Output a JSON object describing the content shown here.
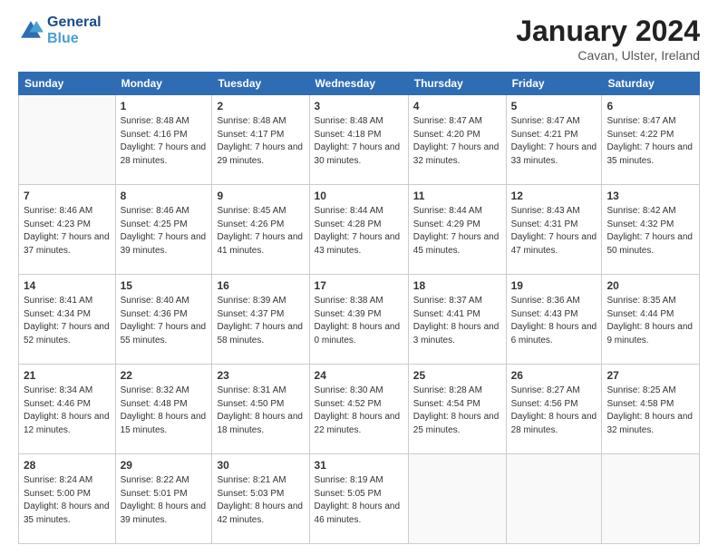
{
  "header": {
    "logo_line1": "General",
    "logo_line2": "Blue",
    "month": "January 2024",
    "location": "Cavan, Ulster, Ireland"
  },
  "days_of_week": [
    "Sunday",
    "Monday",
    "Tuesday",
    "Wednesday",
    "Thursday",
    "Friday",
    "Saturday"
  ],
  "weeks": [
    [
      {
        "day": "",
        "sunrise": "",
        "sunset": "",
        "daylight": ""
      },
      {
        "day": "1",
        "sunrise": "Sunrise: 8:48 AM",
        "sunset": "Sunset: 4:16 PM",
        "daylight": "Daylight: 7 hours and 28 minutes."
      },
      {
        "day": "2",
        "sunrise": "Sunrise: 8:48 AM",
        "sunset": "Sunset: 4:17 PM",
        "daylight": "Daylight: 7 hours and 29 minutes."
      },
      {
        "day": "3",
        "sunrise": "Sunrise: 8:48 AM",
        "sunset": "Sunset: 4:18 PM",
        "daylight": "Daylight: 7 hours and 30 minutes."
      },
      {
        "day": "4",
        "sunrise": "Sunrise: 8:47 AM",
        "sunset": "Sunset: 4:20 PM",
        "daylight": "Daylight: 7 hours and 32 minutes."
      },
      {
        "day": "5",
        "sunrise": "Sunrise: 8:47 AM",
        "sunset": "Sunset: 4:21 PM",
        "daylight": "Daylight: 7 hours and 33 minutes."
      },
      {
        "day": "6",
        "sunrise": "Sunrise: 8:47 AM",
        "sunset": "Sunset: 4:22 PM",
        "daylight": "Daylight: 7 hours and 35 minutes."
      }
    ],
    [
      {
        "day": "7",
        "sunrise": "Sunrise: 8:46 AM",
        "sunset": "Sunset: 4:23 PM",
        "daylight": "Daylight: 7 hours and 37 minutes."
      },
      {
        "day": "8",
        "sunrise": "Sunrise: 8:46 AM",
        "sunset": "Sunset: 4:25 PM",
        "daylight": "Daylight: 7 hours and 39 minutes."
      },
      {
        "day": "9",
        "sunrise": "Sunrise: 8:45 AM",
        "sunset": "Sunset: 4:26 PM",
        "daylight": "Daylight: 7 hours and 41 minutes."
      },
      {
        "day": "10",
        "sunrise": "Sunrise: 8:44 AM",
        "sunset": "Sunset: 4:28 PM",
        "daylight": "Daylight: 7 hours and 43 minutes."
      },
      {
        "day": "11",
        "sunrise": "Sunrise: 8:44 AM",
        "sunset": "Sunset: 4:29 PM",
        "daylight": "Daylight: 7 hours and 45 minutes."
      },
      {
        "day": "12",
        "sunrise": "Sunrise: 8:43 AM",
        "sunset": "Sunset: 4:31 PM",
        "daylight": "Daylight: 7 hours and 47 minutes."
      },
      {
        "day": "13",
        "sunrise": "Sunrise: 8:42 AM",
        "sunset": "Sunset: 4:32 PM",
        "daylight": "Daylight: 7 hours and 50 minutes."
      }
    ],
    [
      {
        "day": "14",
        "sunrise": "Sunrise: 8:41 AM",
        "sunset": "Sunset: 4:34 PM",
        "daylight": "Daylight: 7 hours and 52 minutes."
      },
      {
        "day": "15",
        "sunrise": "Sunrise: 8:40 AM",
        "sunset": "Sunset: 4:36 PM",
        "daylight": "Daylight: 7 hours and 55 minutes."
      },
      {
        "day": "16",
        "sunrise": "Sunrise: 8:39 AM",
        "sunset": "Sunset: 4:37 PM",
        "daylight": "Daylight: 7 hours and 58 minutes."
      },
      {
        "day": "17",
        "sunrise": "Sunrise: 8:38 AM",
        "sunset": "Sunset: 4:39 PM",
        "daylight": "Daylight: 8 hours and 0 minutes."
      },
      {
        "day": "18",
        "sunrise": "Sunrise: 8:37 AM",
        "sunset": "Sunset: 4:41 PM",
        "daylight": "Daylight: 8 hours and 3 minutes."
      },
      {
        "day": "19",
        "sunrise": "Sunrise: 8:36 AM",
        "sunset": "Sunset: 4:43 PM",
        "daylight": "Daylight: 8 hours and 6 minutes."
      },
      {
        "day": "20",
        "sunrise": "Sunrise: 8:35 AM",
        "sunset": "Sunset: 4:44 PM",
        "daylight": "Daylight: 8 hours and 9 minutes."
      }
    ],
    [
      {
        "day": "21",
        "sunrise": "Sunrise: 8:34 AM",
        "sunset": "Sunset: 4:46 PM",
        "daylight": "Daylight: 8 hours and 12 minutes."
      },
      {
        "day": "22",
        "sunrise": "Sunrise: 8:32 AM",
        "sunset": "Sunset: 4:48 PM",
        "daylight": "Daylight: 8 hours and 15 minutes."
      },
      {
        "day": "23",
        "sunrise": "Sunrise: 8:31 AM",
        "sunset": "Sunset: 4:50 PM",
        "daylight": "Daylight: 8 hours and 18 minutes."
      },
      {
        "day": "24",
        "sunrise": "Sunrise: 8:30 AM",
        "sunset": "Sunset: 4:52 PM",
        "daylight": "Daylight: 8 hours and 22 minutes."
      },
      {
        "day": "25",
        "sunrise": "Sunrise: 8:28 AM",
        "sunset": "Sunset: 4:54 PM",
        "daylight": "Daylight: 8 hours and 25 minutes."
      },
      {
        "day": "26",
        "sunrise": "Sunrise: 8:27 AM",
        "sunset": "Sunset: 4:56 PM",
        "daylight": "Daylight: 8 hours and 28 minutes."
      },
      {
        "day": "27",
        "sunrise": "Sunrise: 8:25 AM",
        "sunset": "Sunset: 4:58 PM",
        "daylight": "Daylight: 8 hours and 32 minutes."
      }
    ],
    [
      {
        "day": "28",
        "sunrise": "Sunrise: 8:24 AM",
        "sunset": "Sunset: 5:00 PM",
        "daylight": "Daylight: 8 hours and 35 minutes."
      },
      {
        "day": "29",
        "sunrise": "Sunrise: 8:22 AM",
        "sunset": "Sunset: 5:01 PM",
        "daylight": "Daylight: 8 hours and 39 minutes."
      },
      {
        "day": "30",
        "sunrise": "Sunrise: 8:21 AM",
        "sunset": "Sunset: 5:03 PM",
        "daylight": "Daylight: 8 hours and 42 minutes."
      },
      {
        "day": "31",
        "sunrise": "Sunrise: 8:19 AM",
        "sunset": "Sunset: 5:05 PM",
        "daylight": "Daylight: 8 hours and 46 minutes."
      },
      {
        "day": "",
        "sunrise": "",
        "sunset": "",
        "daylight": ""
      },
      {
        "day": "",
        "sunrise": "",
        "sunset": "",
        "daylight": ""
      },
      {
        "day": "",
        "sunrise": "",
        "sunset": "",
        "daylight": ""
      }
    ]
  ]
}
